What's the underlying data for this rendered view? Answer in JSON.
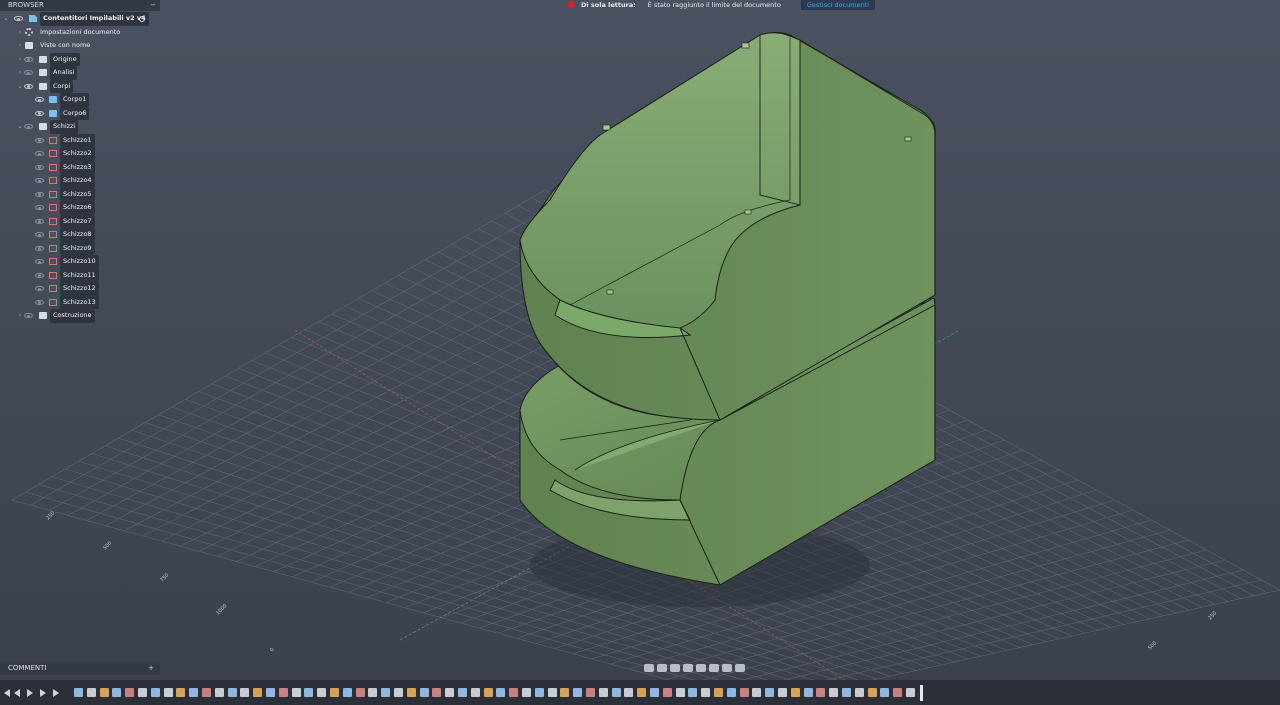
{
  "browser": {
    "header": "BROWSER",
    "items": [
      {
        "label": "Contentitori Impilabili v2 v4",
        "type": "doc",
        "chev": "⌄",
        "level": 0,
        "eye": true,
        "root": true
      },
      {
        "label": "Impostazioni documento",
        "type": "gear",
        "chev": "›",
        "level": 1,
        "eye": false
      },
      {
        "label": "Viste con nome",
        "type": "folder",
        "chev": "›",
        "level": 1,
        "eye": false
      },
      {
        "label": "Origine",
        "type": "folder",
        "chev": "›",
        "level": 1,
        "eye": true,
        "dim": true
      },
      {
        "label": "Analisi",
        "type": "folder",
        "chev": "›",
        "level": 1,
        "eye": true,
        "dim": true
      },
      {
        "label": "Corpi",
        "type": "folder",
        "chev": "⌄",
        "level": 1,
        "eye": true
      },
      {
        "label": "Corpo1",
        "type": "body",
        "chev": "",
        "level": 2,
        "eye": true
      },
      {
        "label": "Corpo6",
        "type": "body",
        "chev": "",
        "level": 2,
        "eye": true
      },
      {
        "label": "Schizzi",
        "type": "folder",
        "chev": "⌄",
        "level": 1,
        "eye": true,
        "dim": true
      },
      {
        "label": "Schizzo1",
        "type": "sketch",
        "chev": "",
        "level": 2,
        "eye": true,
        "dim": true
      },
      {
        "label": "Schizzo2",
        "type": "sketch",
        "chev": "",
        "level": 2,
        "eye": true,
        "dim": true
      },
      {
        "label": "Schizzo3",
        "type": "sketch",
        "chev": "",
        "level": 2,
        "eye": true,
        "dim": true
      },
      {
        "label": "Schizzo4",
        "type": "sketch",
        "chev": "",
        "level": 2,
        "eye": true,
        "dim": true
      },
      {
        "label": "Schizzo5",
        "type": "sketch",
        "chev": "",
        "level": 2,
        "eye": true,
        "dim": true
      },
      {
        "label": "Schizzo6",
        "type": "sketch",
        "chev": "",
        "level": 2,
        "eye": true,
        "dim": true
      },
      {
        "label": "Schizzo7",
        "type": "sketch",
        "chev": "",
        "level": 2,
        "eye": true,
        "dim": true
      },
      {
        "label": "Schizzo8",
        "type": "sketch",
        "chev": "",
        "level": 2,
        "eye": true,
        "dim": true
      },
      {
        "label": "Schizzo9",
        "type": "sketch",
        "chev": "",
        "level": 2,
        "eye": true,
        "dim": true
      },
      {
        "label": "Schizzo10",
        "type": "sketch",
        "chev": "",
        "level": 2,
        "eye": true,
        "dim": true
      },
      {
        "label": "Schizzo11",
        "type": "sketch",
        "chev": "",
        "level": 2,
        "eye": true,
        "dim": true
      },
      {
        "label": "Schizzo12",
        "type": "sketch",
        "chev": "",
        "level": 2,
        "eye": true,
        "dim": true
      },
      {
        "label": "Schizzo13",
        "type": "sketch",
        "chev": "",
        "level": 2,
        "eye": true,
        "dim": true
      },
      {
        "label": "Costruzione",
        "type": "folder",
        "chev": "›",
        "level": 1,
        "eye": true,
        "dim": true
      }
    ]
  },
  "notice": {
    "title": "Di sola lettura:",
    "message": "È stato raggiunto il limite del documento",
    "button": "Gestisci documenti"
  },
  "comments": {
    "label": "COMMENTI",
    "add": "+"
  },
  "grid_labels": [
    "250",
    "500",
    "750",
    "1000",
    "0",
    "250",
    "500"
  ],
  "colors": {
    "background": "#3d4452",
    "model": "#6b8f5b",
    "accent": "#4aa3e8",
    "stop": "#d22222"
  }
}
